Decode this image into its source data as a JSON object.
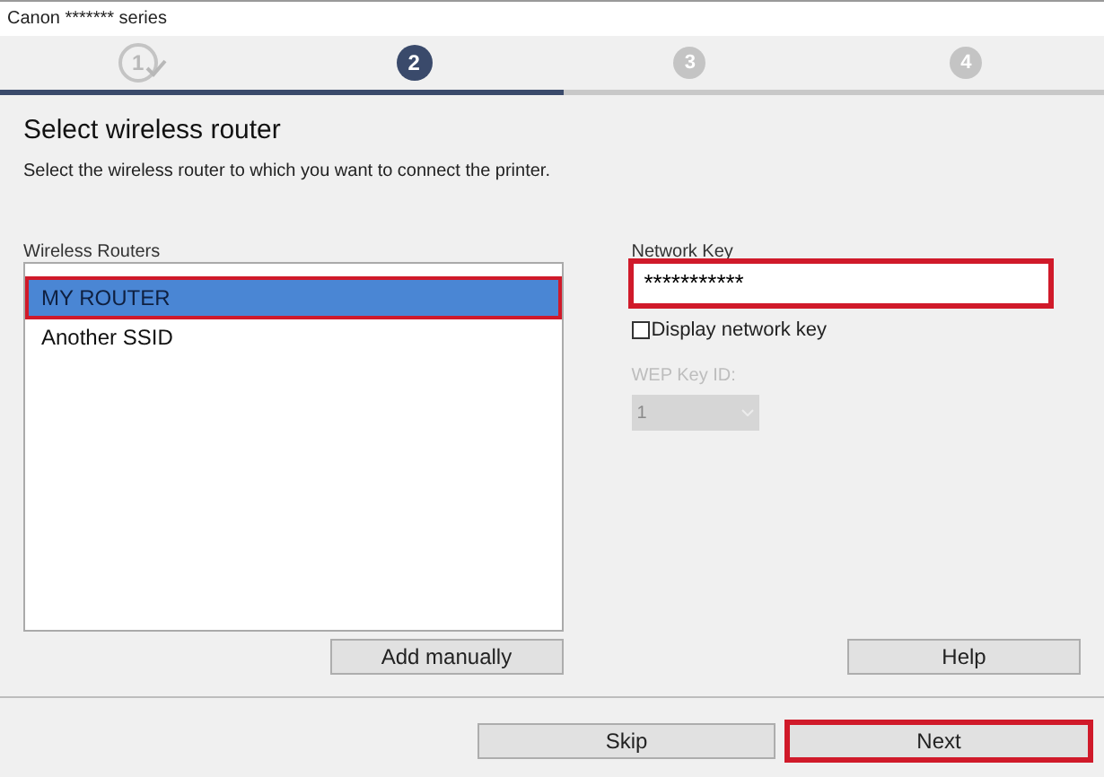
{
  "window": {
    "title": "Canon ******* series"
  },
  "steps": [
    {
      "label": "1",
      "done": true,
      "selected": false
    },
    {
      "label": "2",
      "done": false,
      "selected": true
    },
    {
      "label": "3",
      "done": false,
      "selected": false
    },
    {
      "label": "4",
      "done": false,
      "selected": false
    }
  ],
  "progress": {
    "level": 0.51
  },
  "heading": "Select wireless router",
  "description": "Select the wireless router to which you want to connect the printer.",
  "routers": {
    "label": "Wireless Routers",
    "items": [
      {
        "name": "MY ROUTER",
        "selected": true,
        "highlighted": true
      },
      {
        "name": "Another SSID",
        "selected": false,
        "highlighted": false
      }
    ]
  },
  "network_key": {
    "label": "Network Key",
    "value": "***********",
    "highlighted": true
  },
  "display_key": {
    "label": "Display network key",
    "checked": false
  },
  "wep_key_id": {
    "label": "WEP Key ID:",
    "value": "1",
    "disabled": true
  },
  "buttons": [
    {
      "label": "Add manually",
      "highlighted": false
    },
    {
      "label": "Help",
      "highlighted": false
    }
  ],
  "footer_buttons": [
    {
      "label": "Skip",
      "highlighted": false
    },
    {
      "label": "Next",
      "highlighted": true
    }
  ]
}
